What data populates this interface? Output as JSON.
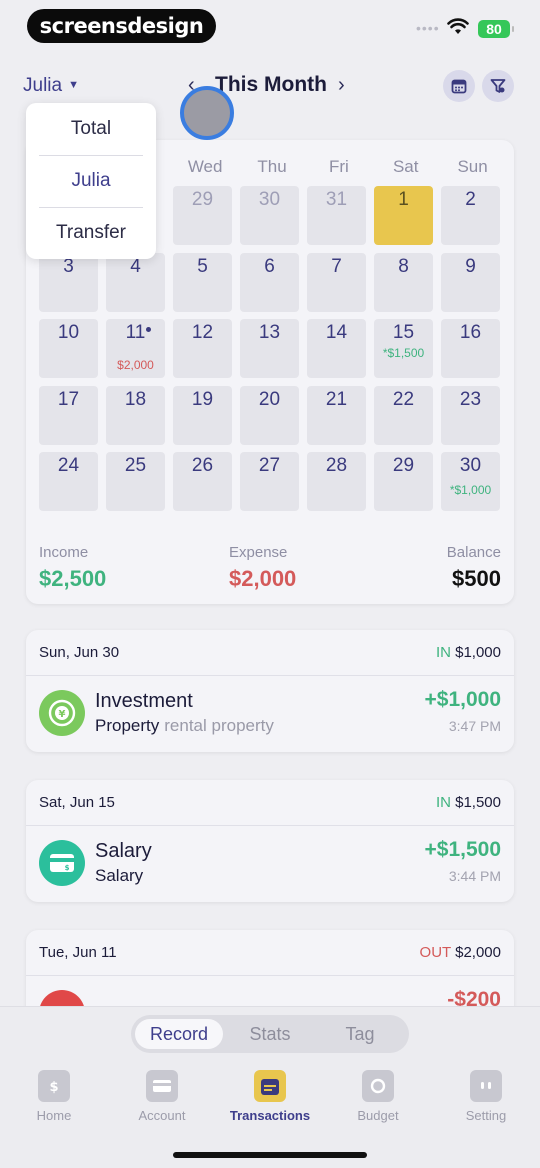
{
  "status_bar": {
    "brand": "screensdesign",
    "battery": "80"
  },
  "header": {
    "user": "Julia",
    "title": "This Month"
  },
  "dropdown": {
    "items": [
      "Total",
      "Julia",
      "Transfer"
    ],
    "selected": "Julia"
  },
  "calendar": {
    "weekdays": [
      "Wed",
      "Thu",
      "Fri",
      "Sat",
      "Sun"
    ],
    "rows": [
      [
        "29",
        "30",
        "31",
        "1",
        "2"
      ],
      [
        "3",
        "4",
        "5",
        "6",
        "7",
        "8",
        "9"
      ],
      [
        "10",
        "11",
        "12",
        "13",
        "14",
        "15",
        "16"
      ],
      [
        "17",
        "18",
        "19",
        "20",
        "21",
        "22",
        "23"
      ],
      [
        "24",
        "25",
        "26",
        "27",
        "28",
        "29",
        "30"
      ]
    ],
    "day_amounts": {
      "d11": "$2,000",
      "d15": "*$1,500",
      "d30": "*$1,000"
    },
    "today": "1",
    "colors": {
      "today": "#e8c64e",
      "income": "#3fb37f",
      "expense": "#d45a5a"
    }
  },
  "summary": {
    "income_label": "Income",
    "income": "$2,500",
    "expense_label": "Expense",
    "expense": "$2,000",
    "balance_label": "Balance",
    "balance": "$500"
  },
  "transactions": [
    {
      "date": "Sun, Jun 30",
      "direction": "IN",
      "total": "$1,000",
      "title": "Investment",
      "category": "Property",
      "note": "rental property",
      "amount": "+$1,000",
      "time": "3:47 PM",
      "icon": "investment-icon"
    },
    {
      "date": "Sat, Jun 15",
      "direction": "IN",
      "total": "$1,500",
      "title": "Salary",
      "category": "Salary",
      "note": "",
      "amount": "+$1,500",
      "time": "3:44 PM",
      "icon": "salary-card-icon"
    },
    {
      "date": "Tue, Jun 11",
      "direction": "OUT",
      "total": "$2,000",
      "amount": "-$200",
      "icon": "shopping-icon"
    }
  ],
  "segmented": {
    "items": [
      "Record",
      "Stats",
      "Tag"
    ],
    "selected": "Record"
  },
  "tabbar": {
    "items": [
      "Home",
      "Account",
      "Transactions",
      "Budget",
      "Setting"
    ],
    "active": "Transactions"
  }
}
